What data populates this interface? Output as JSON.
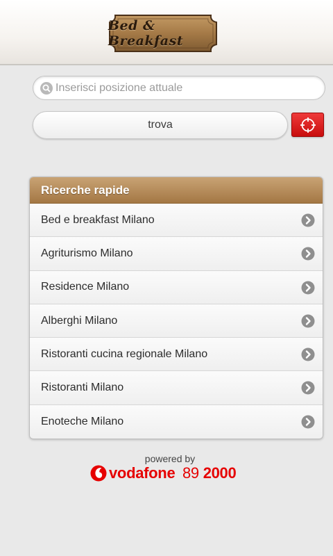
{
  "header": {
    "logo_text": "Bed & Breakfast",
    "logo_icon": "bed-and-breakfast-logo-icon"
  },
  "search": {
    "placeholder": "Inserisci posizione attuale",
    "value": "",
    "icon": "search-icon"
  },
  "actions": {
    "find_label": "trova",
    "locate_icon": "crosshair-icon"
  },
  "quick_search": {
    "title": "Ricerche rapide",
    "items": [
      {
        "label": "Bed e breakfast Milano"
      },
      {
        "label": "Agriturismo Milano"
      },
      {
        "label": "Residence Milano"
      },
      {
        "label": "Alberghi Milano"
      },
      {
        "label": "Ristoranti cucina regionale Milano"
      },
      {
        "label": "Ristoranti Milano"
      },
      {
        "label": "Enoteche Milano"
      }
    ]
  },
  "footer": {
    "powered_by": "powered by",
    "brand_name": "vodafone",
    "brand_number_prefix": "89",
    "brand_number_suffix": "2000"
  },
  "colors": {
    "accent_red": "#e60000",
    "header_brown": "#b08550",
    "background": "#e9e9e9"
  }
}
